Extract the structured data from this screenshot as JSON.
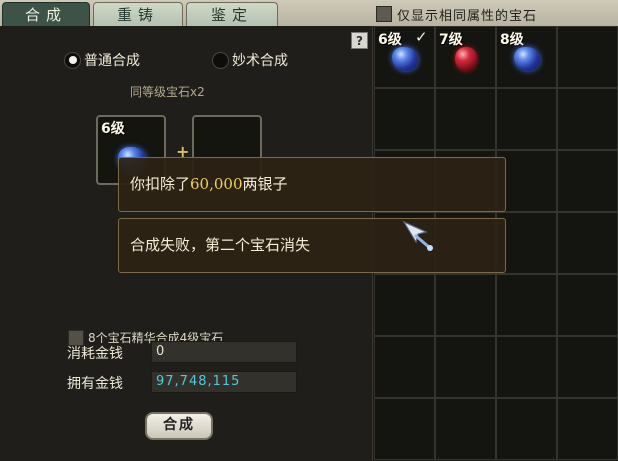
{
  "tabs": [
    {
      "label": "合成",
      "active": true
    },
    {
      "label": "重铸",
      "active": false
    },
    {
      "label": "鉴定",
      "active": false
    }
  ],
  "filter_label": "仅显示相同属性的宝石",
  "help_label": "?",
  "modes": [
    {
      "label": "普通合成",
      "selected": true
    },
    {
      "label": "妙术合成",
      "selected": false
    }
  ],
  "same_level_label": "同等级宝石x2",
  "slot1_level": "6级",
  "messages": {
    "deduct_prefix": "你扣除了",
    "deduct_amount": "60,000",
    "deduct_suffix": "两银子",
    "fail": "合成失败，第二个宝石消失"
  },
  "combo4_label": "8个宝石精华合成4级宝石",
  "cost_label": "消耗金钱",
  "cost_value": "0",
  "owned_label": "拥有金钱",
  "owned_value": "97,748,115",
  "combine_button": "合成",
  "inventory": [
    {
      "level": "6级",
      "checked": true,
      "gem": "blue-gem-icon"
    },
    {
      "level": "7级",
      "checked": false,
      "gem": "red-gem-icon"
    },
    {
      "level": "8级",
      "checked": false,
      "gem": "blue-gem-icon"
    }
  ],
  "colors": {
    "tab_active": "#3e5347",
    "money_cyan": "#55c8d8",
    "gold_text": "#f0d058"
  }
}
